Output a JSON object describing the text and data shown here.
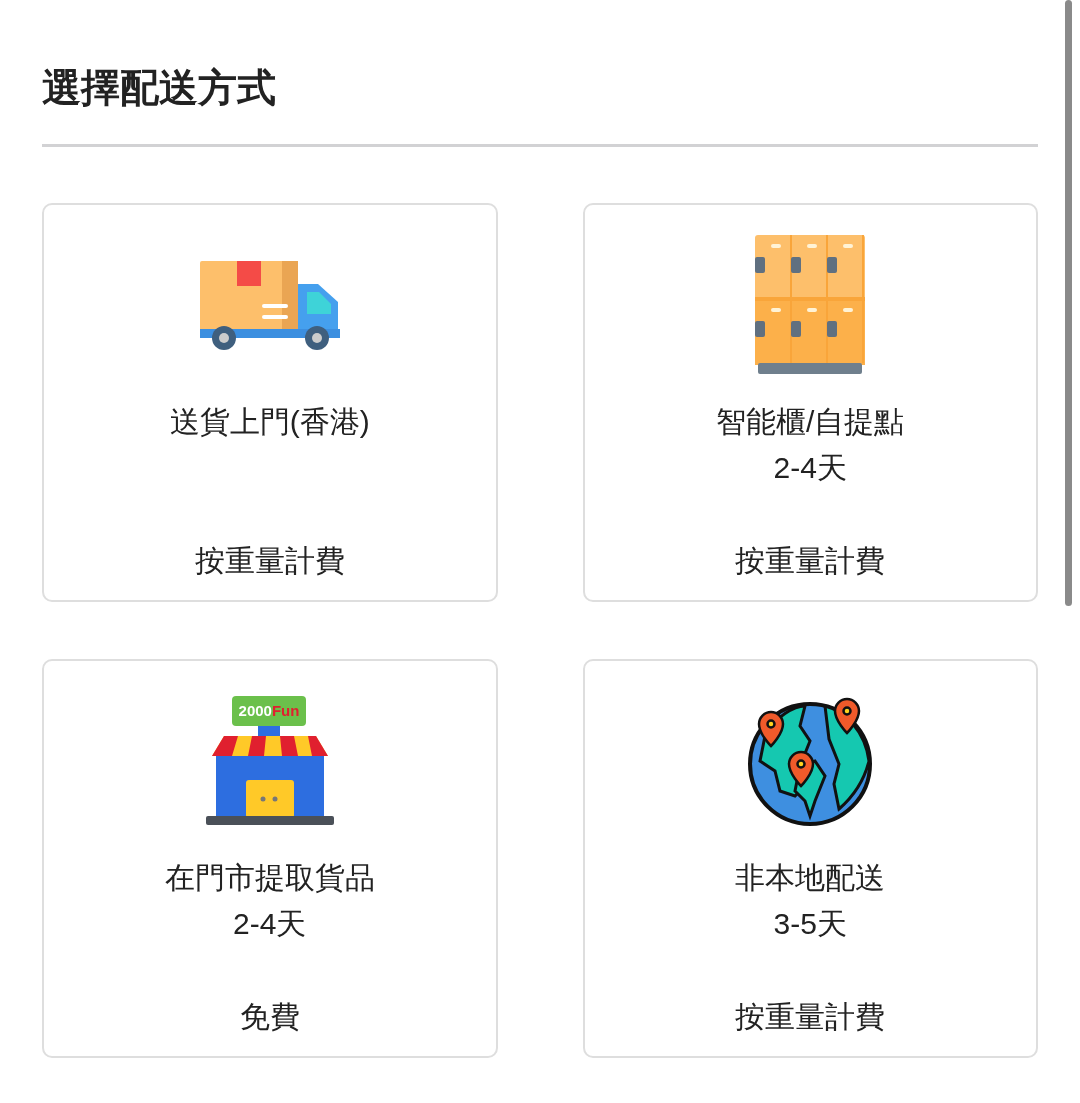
{
  "title": "選擇配送方式",
  "options": [
    {
      "kind": "truck",
      "name": "送貨上門(香港)",
      "price": "按重量計費"
    },
    {
      "kind": "lockers",
      "name": "智能櫃/自提點",
      "days": "2-4天",
      "price": "按重量計費"
    },
    {
      "kind": "store",
      "sign": "2000Fun",
      "name": "在門市提取貨品",
      "days": "2-4天",
      "price": "免費"
    },
    {
      "kind": "globe",
      "name": "非本地配送",
      "days": "3-5天",
      "price": "按重量計費"
    }
  ]
}
